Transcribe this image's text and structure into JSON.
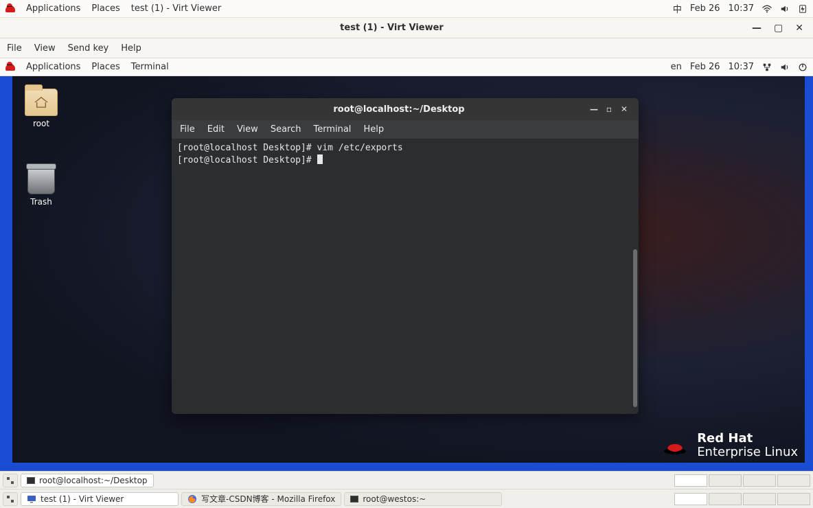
{
  "host_topbar": {
    "applications": "Applications",
    "places": "Places",
    "current_app": "test (1) - Virt Viewer",
    "ime": "中",
    "date": "Feb 26",
    "time": "10:37"
  },
  "virt_viewer": {
    "title": "test (1) - Virt Viewer",
    "menu": {
      "file": "File",
      "view": "View",
      "sendkey": "Send key",
      "help": "Help"
    }
  },
  "guest_topbar": {
    "applications": "Applications",
    "places": "Places",
    "current_app": "Terminal",
    "lang": "en",
    "date": "Feb 26",
    "time": "10:37"
  },
  "desktop_icons": {
    "root": "root",
    "trash": "Trash"
  },
  "brand": {
    "line1": "Red Hat",
    "line2": "Enterprise Linux"
  },
  "terminal": {
    "title": "root@localhost:~/Desktop",
    "menu": {
      "file": "File",
      "edit": "Edit",
      "view": "View",
      "search": "Search",
      "terminal": "Terminal",
      "help": "Help"
    },
    "lines": [
      "[root@localhost Desktop]# vim /etc/exports",
      "[root@localhost Desktop]# "
    ]
  },
  "guest_taskbar": {
    "item1": "root@localhost:~/Desktop"
  },
  "host_taskbar": {
    "item1": "test (1) - Virt Viewer",
    "item2": "写文章-CSDN博客 - Mozilla Firefox",
    "item3": "root@westos:~"
  }
}
